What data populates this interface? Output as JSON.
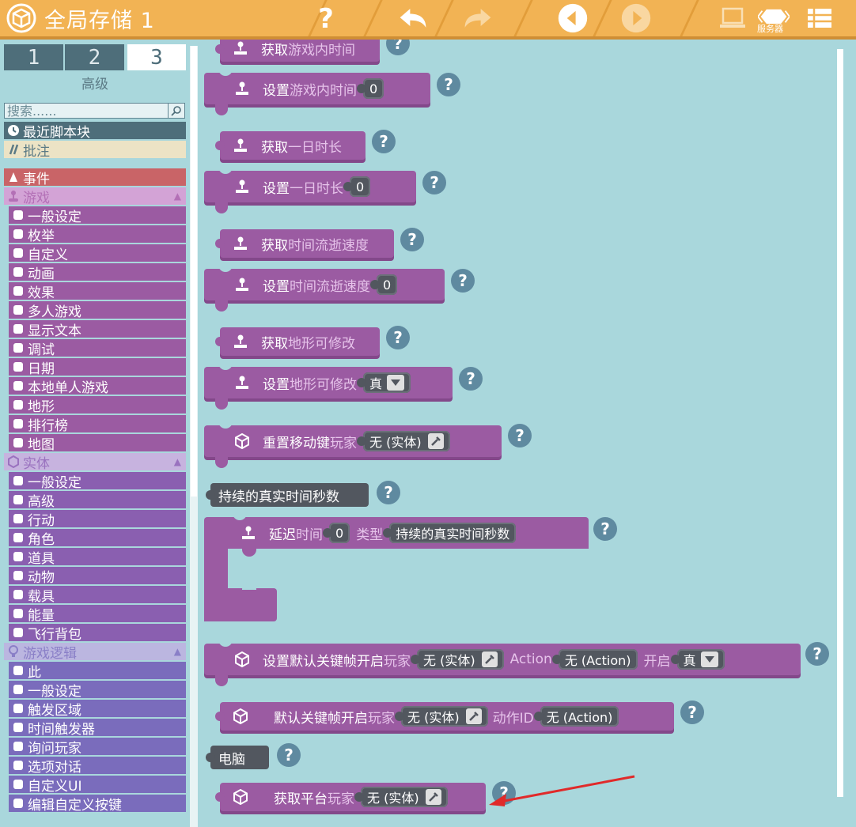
{
  "app": {
    "title": "全局存储 1",
    "server_label": "服务器"
  },
  "toolbar": {
    "help_icon": "question-icon",
    "undo_icon": "undo-icon",
    "redo_icon": "redo-icon",
    "prev_icon": "prev-icon",
    "next_icon": "next-icon",
    "laptop_icon": "laptop-icon",
    "server_icon": "server-icon",
    "menu_icon": "list-icon"
  },
  "sidebar": {
    "tabs": [
      "1",
      "2",
      "3"
    ],
    "active_tab_caption": "高级",
    "search_placeholder": "搜索......",
    "recent": "最近脚本块",
    "note": "批注",
    "categories": [
      {
        "label": "事件",
        "color": "#c96467"
      },
      {
        "label": "游戏",
        "color": "#b370b6",
        "sub_color": "#9b5ba2",
        "items": [
          "一般设定",
          "枚举",
          "自定义",
          "动画",
          "效果",
          "多人游戏",
          "显示文本",
          "调试",
          "日期",
          "本地单人游戏",
          "地形",
          "排行榜",
          "地图"
        ]
      },
      {
        "label": "实体",
        "color": "#9a72bf",
        "sub_color": "#8a5fb0",
        "items": [
          "一般设定",
          "高级",
          "行动",
          "角色",
          "道具",
          "动物",
          "载具",
          "能量",
          "飞行背包"
        ]
      },
      {
        "label": "游戏逻辑",
        "color": "#8a7fc7",
        "sub_color": "#7a6cbc",
        "items": [
          "此",
          "一般设定",
          "触发区域",
          "时间触发器",
          "询问玩家",
          "选项对话",
          "自定义UI",
          "编辑自定义按键"
        ]
      }
    ]
  },
  "workspace": {
    "blocks": {
      "b1": {
        "label": "获取",
        "dim": "游戏内时间"
      },
      "b2": {
        "label": "设置",
        "dim": "游戏内时间",
        "value": "0"
      },
      "b3": {
        "label": "获取",
        "dim": "一日时长"
      },
      "b4": {
        "label": "设置",
        "dim": "一日时长",
        "value": "0"
      },
      "b5": {
        "label": "获取",
        "dim": "时间流逝速度"
      },
      "b6": {
        "label": "设置",
        "dim": "时间流逝速度",
        "value": "0"
      },
      "b7": {
        "label": "获取",
        "dim": "地形可修改"
      },
      "b8": {
        "label": "设置",
        "dim": "地形可修改",
        "value": "真"
      },
      "b9": {
        "label": "重置移动键",
        "dim": "玩家",
        "value": "无 (实体)"
      },
      "b10": {
        "label": "持续的真实时间秒数"
      },
      "b11": {
        "label": "延迟",
        "dim": "时间",
        "value": "0",
        "dim2": "类型",
        "value2": "持续的真实时间秒数"
      },
      "b12": {
        "label": "设置默认关键帧开启",
        "dim": "玩家",
        "value": "无 (实体)",
        "dim2": "Action",
        "value2": "无 (Action)",
        "dim3": "开启",
        "value3": "真"
      },
      "b13": {
        "label": "默认关键帧开启",
        "dim": "玩家",
        "value": "无 (实体)",
        "dim2": "动作ID",
        "value2": "无 (Action)"
      },
      "b14": {
        "label": "电脑"
      },
      "b15": {
        "label": "获取平台",
        "dim": "玩家",
        "value": "无 (实体)"
      }
    },
    "help": "?"
  },
  "colors": {
    "topbar": "#f2b354",
    "background": "#a9d7dc",
    "block_purple": "#9b5ba2",
    "slot_gray": "#52575f",
    "arrow_red": "#e02a2a"
  }
}
